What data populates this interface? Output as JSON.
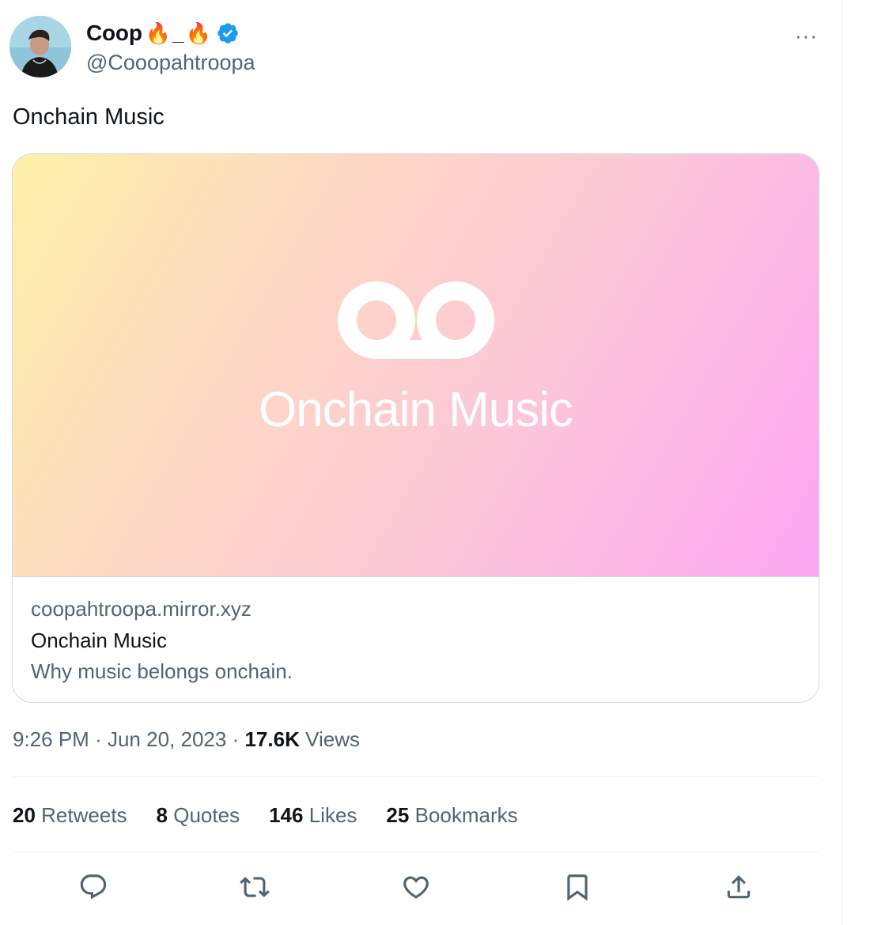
{
  "author": {
    "display_name": "Coop",
    "name_emoji_1": "🔥",
    "name_separator": "_",
    "name_emoji_2": "🔥",
    "handle": "@Cooopahtroopa"
  },
  "more_glyph": "···",
  "tweet": {
    "text": "Onchain Music"
  },
  "card": {
    "image_wordmark": "Onchain Music",
    "domain": "coopahtroopa.mirror.xyz",
    "title": "Onchain Music",
    "description": "Why music belongs onchain."
  },
  "meta": {
    "time": "9:26 PM",
    "separator": "·",
    "date": "Jun 20, 2023",
    "views_count": "17.6K",
    "views_label": "Views"
  },
  "stats": {
    "retweets_count": "20",
    "retweets_label": "Retweets",
    "quotes_count": "8",
    "quotes_label": "Quotes",
    "likes_count": "146",
    "likes_label": "Likes",
    "bookmarks_count": "25",
    "bookmarks_label": "Bookmarks"
  },
  "colors": {
    "accent_blue": "#1d9bf0",
    "secondary_text": "#536471",
    "primary_text": "#0f1419",
    "border": "#cfd9de"
  },
  "icons": [
    "verified-badge-icon",
    "more-icon",
    "voicemail-logo-icon",
    "reply-icon",
    "retweet-icon",
    "like-icon",
    "bookmark-icon",
    "share-icon"
  ]
}
